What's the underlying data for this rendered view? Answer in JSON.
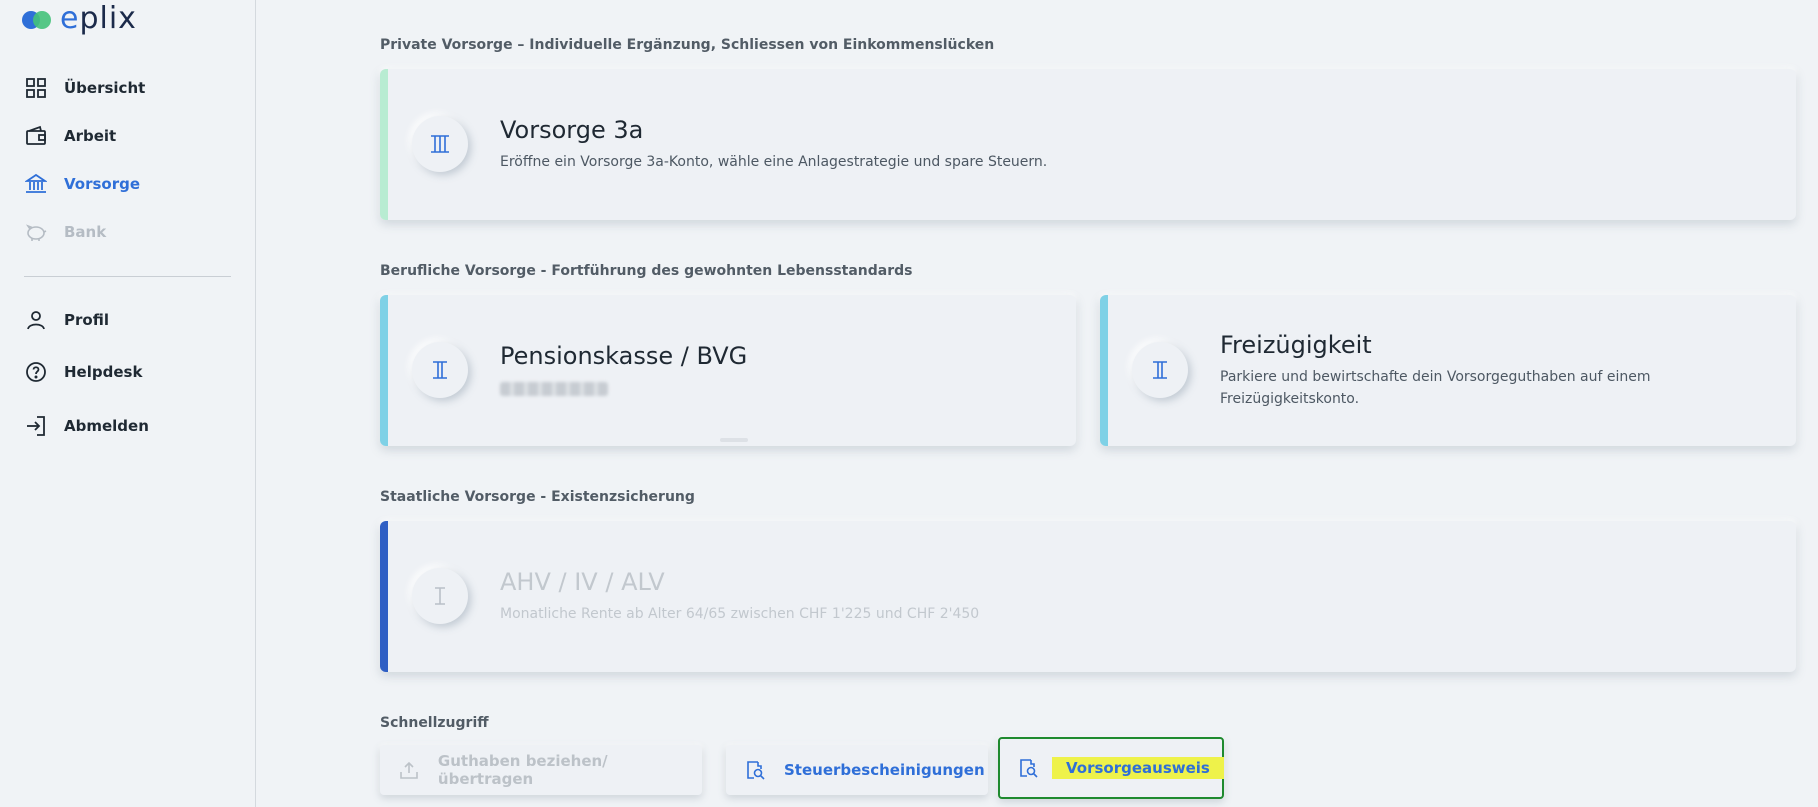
{
  "brand": {
    "name_prefix": "e",
    "name_rest": "plix"
  },
  "nav": {
    "items": [
      {
        "label": "Übersicht",
        "icon": "grid-icon",
        "state": "normal"
      },
      {
        "label": "Arbeit",
        "icon": "wallet-icon",
        "state": "normal"
      },
      {
        "label": "Vorsorge",
        "icon": "bank-icon",
        "state": "active"
      },
      {
        "label": "Bank",
        "icon": "piggy-bank-icon",
        "state": "disabled"
      }
    ],
    "secondary": [
      {
        "label": "Profil",
        "icon": "user-icon"
      },
      {
        "label": "Helpdesk",
        "icon": "help-circle-icon"
      },
      {
        "label": "Abmelden",
        "icon": "logout-icon"
      }
    ]
  },
  "sections": {
    "private": {
      "title": "Private Vorsorge – Individuelle Ergänzung, Schliessen von Einkommenslücken",
      "card": {
        "title": "Vorsorge 3a",
        "subtitle": "Eröffne ein Vorsorge 3a-Konto, wähle eine Anlagestrategie und spare Steuern.",
        "accent": "#b8ecd2"
      }
    },
    "occupational": {
      "title": "Berufliche Vorsorge - Fortführung des gewohnten Lebensstandards",
      "cards": [
        {
          "title": "Pensionskasse / BVG",
          "subtitle": "",
          "accent": "#7fd1e6"
        },
        {
          "title": "Freizügigkeit",
          "subtitle_line1": "Parkiere und bewirtschafte dein Vorsorgeguthaben auf einem",
          "subtitle_line2": "Freizügigkeitskonto.",
          "accent": "#7fd1e6"
        }
      ]
    },
    "state": {
      "title": "Staatliche Vorsorge - Existenzsicherung",
      "card": {
        "title": "AHV / IV / ALV",
        "subtitle": "Monatliche Rente ab Alter 64/65 zwischen CHF 1'225 und CHF 2'450",
        "accent": "#2f5fc4"
      }
    },
    "quick": {
      "title": "Schnellzugriff",
      "buttons": [
        {
          "label": "Guthaben beziehen/übertragen",
          "icon": "upload-icon",
          "state": "disabled"
        },
        {
          "label": "Steuerbescheinigungen",
          "icon": "document-search-icon",
          "state": "normal"
        },
        {
          "label": "Vorsorgeausweis",
          "icon": "document-search-icon",
          "state": "selected"
        }
      ]
    }
  },
  "colors": {
    "primary": "#2f6fd8",
    "background": "#f0f3f6",
    "highlight": "#eef24a",
    "selection_border": "#1f8a2f"
  }
}
